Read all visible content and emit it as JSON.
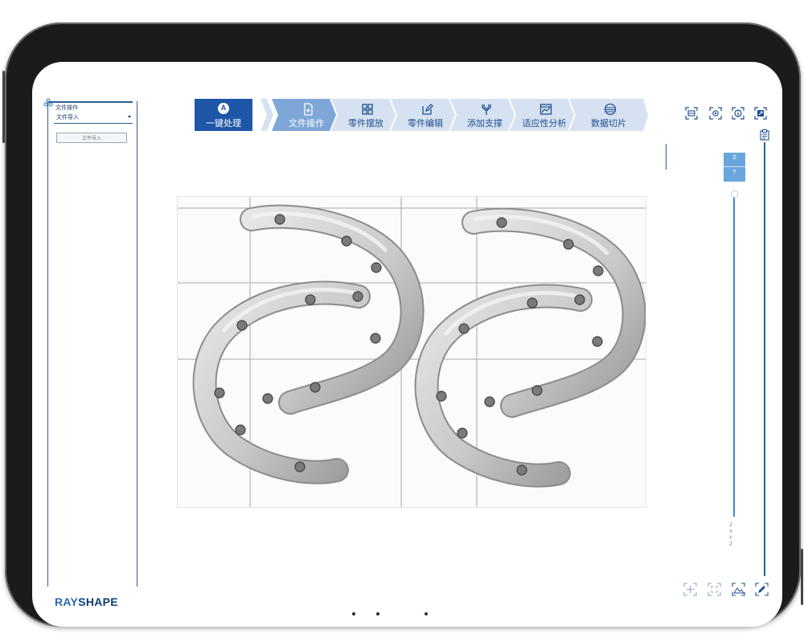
{
  "left_panel": {
    "title": "文件操作",
    "select_value": "文件导入",
    "button_label": "文件导入"
  },
  "brand": {
    "part1": "RAY",
    "part2": "SHAPE"
  },
  "toolbar": {
    "main": {
      "label": "一键处理",
      "icon": "A"
    },
    "steps": [
      {
        "label": "文件操作",
        "icon": "file-add-icon",
        "active": true
      },
      {
        "label": "零件摆放",
        "icon": "grid-icon"
      },
      {
        "label": "零件编辑",
        "icon": "edit-icon"
      },
      {
        "label": "添加支撑",
        "icon": "support-icon"
      },
      {
        "label": "适应性分析",
        "icon": "analysis-icon"
      },
      {
        "label": "数据切片",
        "icon": "slice-icon"
      }
    ]
  },
  "axis_labels": {
    "z": "Z",
    "y": "Y"
  },
  "slider_values": [
    "Z",
    "X",
    "Y",
    "Z"
  ],
  "colors": {
    "primary": "#1e57a8",
    "step_active": "#7ea7d8",
    "step_inactive": "#d6e2f1",
    "line": "#2b5f8d",
    "axis_bg": "#6aa6de"
  }
}
